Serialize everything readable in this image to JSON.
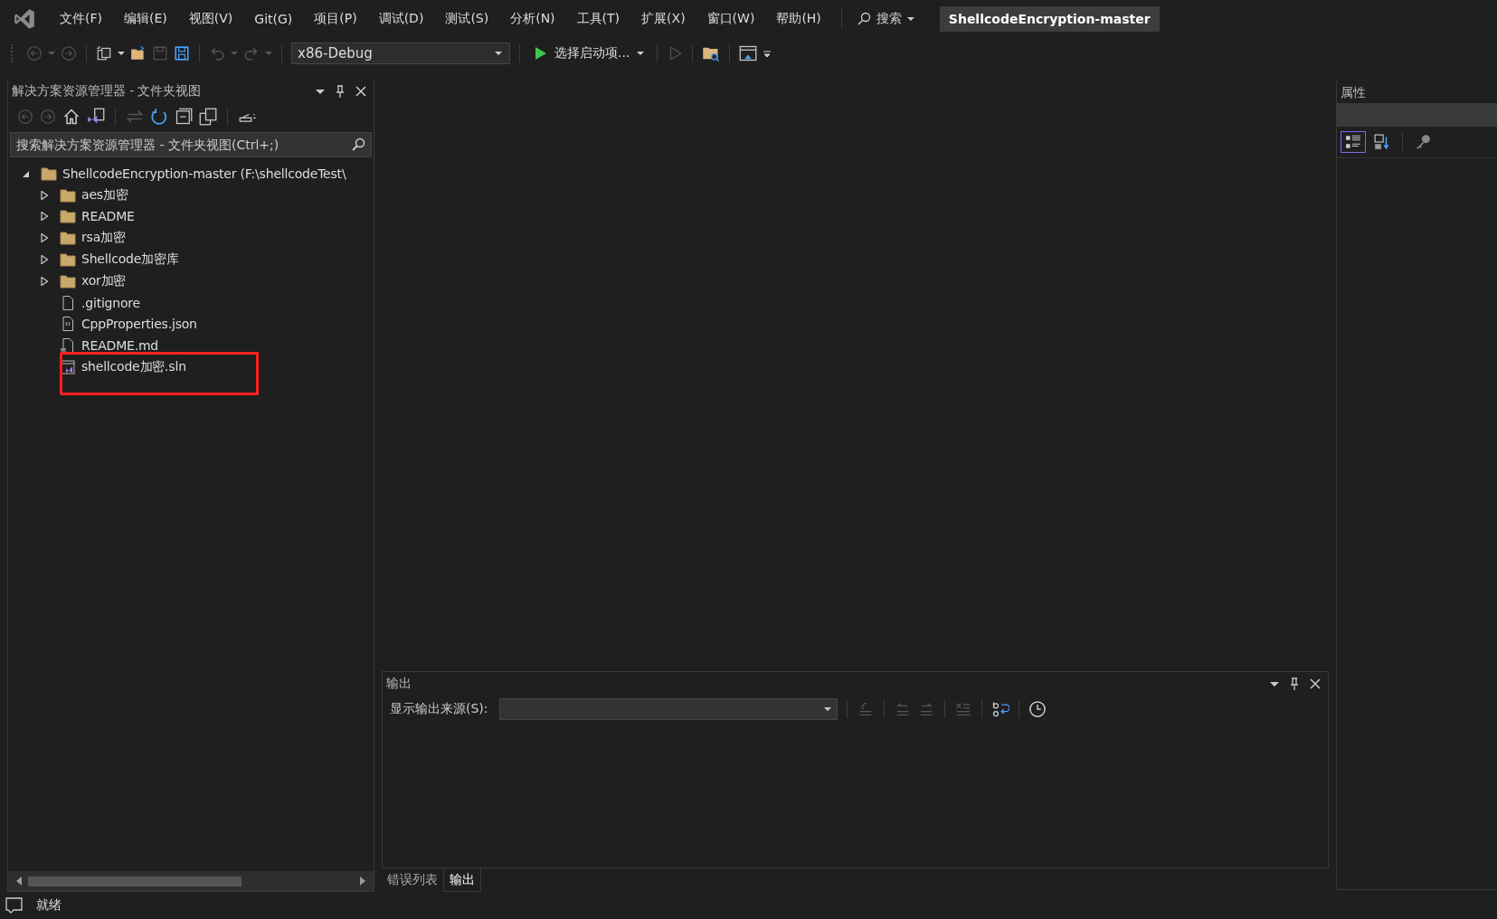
{
  "menu": [
    "文件(F)",
    "编辑(E)",
    "视图(V)",
    "Git(G)",
    "项目(P)",
    "调试(D)",
    "测试(S)",
    "分析(N)",
    "工具(T)",
    "扩展(X)",
    "窗口(W)",
    "帮助(H)"
  ],
  "search": {
    "label": "搜索"
  },
  "title": "ShellcodeEncryption-master",
  "toolbar": {
    "configuration": "x86-Debug",
    "start": "选择启动项..."
  },
  "solution_explorer": {
    "title": "解决方案资源管理器 - 文件夹视图",
    "search": {
      "placeholder": "搜索解决方案资源管理器 - 文件夹视图(Ctrl+;)"
    },
    "tree": [
      {
        "label": "ShellcodeEncryption-master (F:\\shellcodeTest\\",
        "kind": "folder",
        "expanded": true,
        "highlighted": false,
        "children": [
          {
            "label": "aes加密",
            "kind": "folder",
            "expanded": false,
            "highlighted": false
          },
          {
            "label": "README",
            "kind": "folder",
            "expanded": false,
            "highlighted": false
          },
          {
            "label": "rsa加密",
            "kind": "folder",
            "expanded": false,
            "highlighted": false
          },
          {
            "label": "Shellcode加密库",
            "kind": "folder",
            "expanded": false,
            "highlighted": false
          },
          {
            "label": "xor加密",
            "kind": "folder",
            "expanded": false,
            "highlighted": false
          },
          {
            "label": ".gitignore",
            "kind": "file",
            "highlighted": false
          },
          {
            "label": "CppProperties.json",
            "kind": "json",
            "highlighted": false
          },
          {
            "label": "README.md",
            "kind": "markdown",
            "highlighted": false
          },
          {
            "label": "shellcode加密.sln",
            "kind": "solution",
            "highlighted": true
          }
        ]
      }
    ]
  },
  "output": {
    "title": "输出",
    "source_label": "显示输出来源(S):"
  },
  "bottom_tabs": [
    {
      "label": "错误列表",
      "selected": false
    },
    {
      "label": "输出",
      "selected": true
    }
  ],
  "properties": {
    "title": "属性",
    "view_buttons": [
      {
        "kind": "categorized",
        "selected": true
      },
      {
        "kind": "alphabetical",
        "selected": false
      },
      {
        "kind": "pages",
        "selected": false
      }
    ]
  },
  "status": "就绪"
}
